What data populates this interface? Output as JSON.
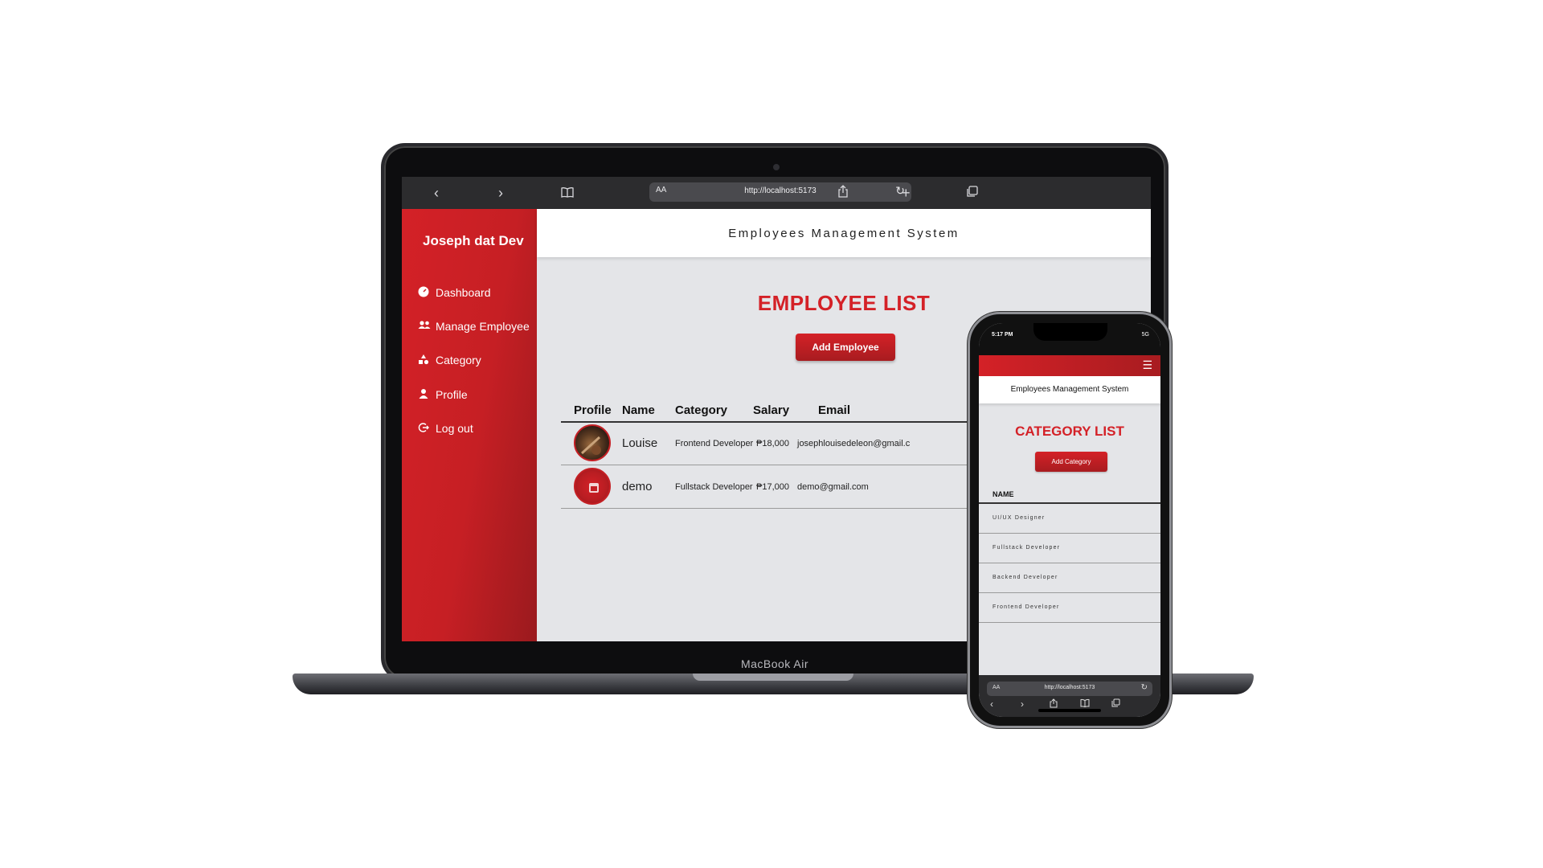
{
  "laptop": {
    "device_label": "MacBook Air",
    "browser": {
      "text_size_label": "AA",
      "url": "http://localhost:5173"
    },
    "sidebar": {
      "brand": "Joseph dat Dev",
      "items": [
        {
          "label": "Dashboard",
          "icon": "dashboard-icon"
        },
        {
          "label": "Manage Employee",
          "icon": "users-icon"
        },
        {
          "label": "Category",
          "icon": "shapes-icon"
        },
        {
          "label": "Profile",
          "icon": "person-icon"
        },
        {
          "label": "Log out",
          "icon": "logout-icon"
        }
      ]
    },
    "header": {
      "title": "Employees Management System"
    },
    "main": {
      "page_title": "EMPLOYEE LIST",
      "add_button": "Add Employee",
      "columns": [
        "Profile",
        "Name",
        "Category",
        "Salary",
        "Email"
      ],
      "rows": [
        {
          "name": "Louise",
          "category": "Frontend Developer",
          "salary": "₱18,000",
          "email": "josephlouisedeleon@gmail.c",
          "avatar": "photo-avatar"
        },
        {
          "name": "demo",
          "category": "Fullstack Developer",
          "salary": "₱17,000",
          "email": "demo@gmail.com",
          "avatar": "red-avatar"
        }
      ]
    }
  },
  "phone": {
    "status": {
      "time": "5:17 PM",
      "signal": "5G"
    },
    "header": {
      "title": "Employees Management System"
    },
    "page_title": "CATEGORY LIST",
    "add_button": "Add Category",
    "column": "NAME",
    "items": [
      "UI/UX Designer",
      "Fullstack Developer",
      "Backend Developer",
      "Frontend Developer"
    ],
    "browser": {
      "text_size_label": "AA",
      "url": "http://localhost:5173"
    }
  },
  "colors": {
    "accent": "#d42127",
    "accent_dark": "#a81c20",
    "content_bg": "#e4e5e8",
    "browser_chrome": "#2c2c2e"
  }
}
